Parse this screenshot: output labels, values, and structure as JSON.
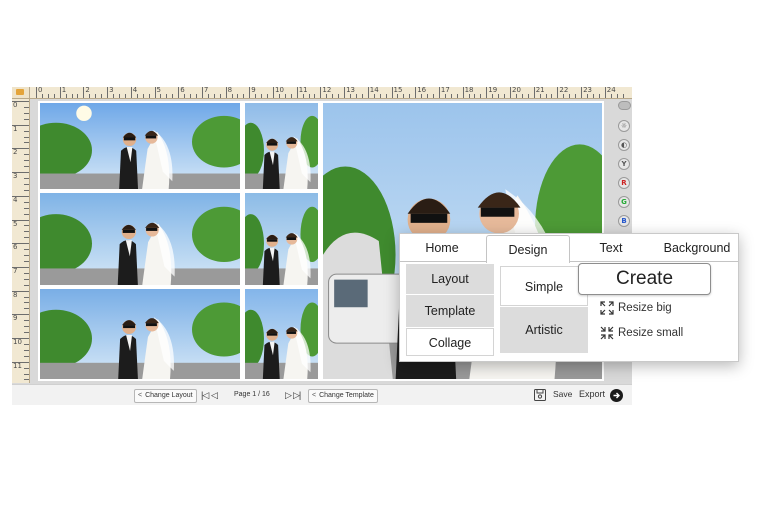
{
  "ruler": {
    "top_numbers": [
      "0",
      "1",
      "2",
      "3",
      "4",
      "5",
      "6",
      "7",
      "8",
      "9",
      "10",
      "11",
      "12",
      "13",
      "14",
      "15",
      "16",
      "17",
      "18",
      "19",
      "20",
      "21",
      "22",
      "23",
      "24"
    ],
    "left_numbers": [
      "0",
      "1",
      "2",
      "3",
      "4",
      "5",
      "6",
      "7",
      "8",
      "9",
      "10",
      "11"
    ]
  },
  "photos": [
    {
      "id": "photo-1",
      "sky": "#6fa8e8"
    },
    {
      "id": "photo-2",
      "sky": "#8fbbe8"
    },
    {
      "id": "photo-3",
      "sky": "#7fb3e6"
    },
    {
      "id": "photo-4",
      "sky": "#8cbbe6"
    },
    {
      "id": "photo-5",
      "sky": "#79aee6"
    },
    {
      "id": "photo-6",
      "sky": "#83b5ea"
    },
    {
      "id": "photo-main",
      "sky": "#9cc4ec"
    }
  ],
  "side_tools": [
    {
      "icon": "toggle-icon",
      "glyph": "",
      "color": "#888888"
    },
    {
      "icon": "sun-icon",
      "glyph": "☼",
      "color": "#555555"
    },
    {
      "icon": "contrast-icon",
      "glyph": "◐",
      "color": "#555555"
    },
    {
      "icon": "yellow-channel-icon",
      "glyph": "Y",
      "color": "#555555"
    },
    {
      "icon": "red-channel-icon",
      "glyph": "R",
      "color": "#cc2222"
    },
    {
      "icon": "green-channel-icon",
      "glyph": "G",
      "color": "#22aa33"
    },
    {
      "icon": "blue-channel-icon",
      "glyph": "B",
      "color": "#2255cc"
    }
  ],
  "bottom_bar": {
    "change_layout": "Change Layout",
    "page_label": "Page 1 / 16",
    "change_template": "Change Template",
    "save": "Save",
    "export": "Export"
  },
  "popup": {
    "tabs": [
      "Home",
      "Design",
      "Text",
      "Background"
    ],
    "active_tab": "Design",
    "left_menu": [
      "Layout",
      "Template",
      "Collage"
    ],
    "styles": [
      "Simple",
      "Artistic"
    ],
    "create": "Create",
    "resize_big": "Resize big",
    "resize_small": "Resize small"
  }
}
